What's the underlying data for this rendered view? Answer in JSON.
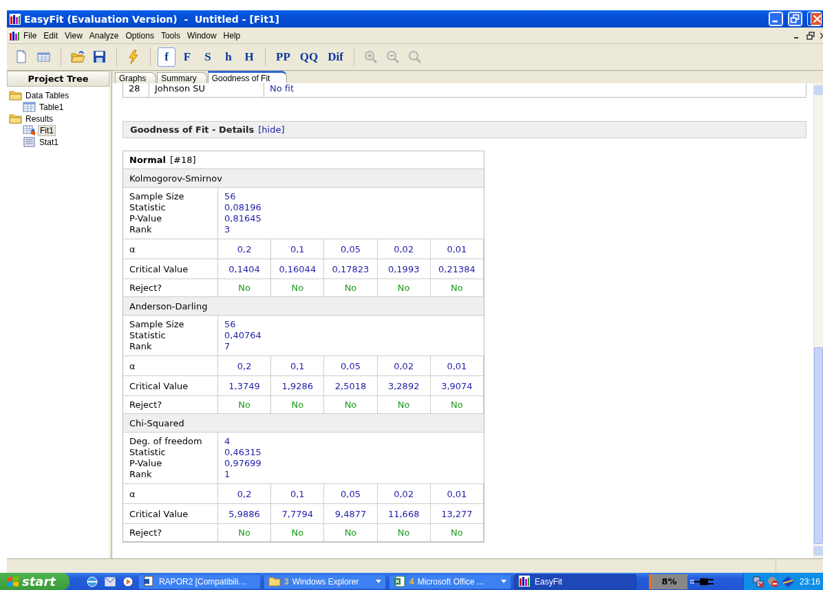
{
  "window": {
    "title": "EasyFit (Evaluation Version)  -  Untitled - [Fit1]"
  },
  "menu": [
    "File",
    "Edit",
    "View",
    "Analyze",
    "Options",
    "Tools",
    "Window",
    "Help"
  ],
  "toolbar": [
    {
      "kind": "new"
    },
    {
      "kind": "table"
    },
    {
      "kind": "separator"
    },
    {
      "kind": "open"
    },
    {
      "kind": "save"
    },
    {
      "kind": "separator"
    },
    {
      "kind": "run"
    },
    {
      "kind": "separator"
    },
    {
      "kind": "text",
      "label": "f",
      "selected": true
    },
    {
      "kind": "text",
      "label": "F",
      "selected": false
    },
    {
      "kind": "text",
      "label": "S",
      "selected": false
    },
    {
      "kind": "text",
      "label": "h",
      "selected": false
    },
    {
      "kind": "text",
      "label": "H",
      "selected": false
    },
    {
      "kind": "separator"
    },
    {
      "kind": "text",
      "label": "PP",
      "selected": false
    },
    {
      "kind": "text",
      "label": "QQ",
      "selected": false
    },
    {
      "kind": "text",
      "label": "Dif",
      "selected": false
    },
    {
      "kind": "separator"
    },
    {
      "kind": "zoom-in",
      "disabled": true
    },
    {
      "kind": "zoom-out",
      "disabled": true
    },
    {
      "kind": "zoom",
      "disabled": true
    }
  ],
  "sidebar": {
    "title": "Project Tree",
    "items": [
      {
        "label": "Data Tables",
        "kind": "folder",
        "selected": false,
        "children": [
          {
            "label": "Table1",
            "kind": "table",
            "selected": false
          }
        ]
      },
      {
        "label": "Results",
        "kind": "folder",
        "selected": false,
        "children": [
          {
            "label": "Fit1",
            "kind": "fit",
            "selected": true
          },
          {
            "label": "Stat1",
            "kind": "stat",
            "selected": false
          }
        ]
      }
    ]
  },
  "tabs": [
    {
      "label": "Graphs",
      "selected": false
    },
    {
      "label": "Summary",
      "selected": false
    },
    {
      "label": "Goodness of Fit",
      "selected": true
    }
  ],
  "partial_row": {
    "rank": "28",
    "distribution": "Johnson SU",
    "result": "No fit"
  },
  "details": {
    "title": "Goodness of Fit - Details",
    "toggle": "[hide]",
    "distribution": "Normal",
    "distribution_id": "[#18]",
    "tests": [
      {
        "name": "Kolmogorov-Smirnov",
        "stats": [
          {
            "label": "Sample Size",
            "value": "56"
          },
          {
            "label": "Statistic",
            "value": "0,08196"
          },
          {
            "label": "P-Value",
            "value": "0,81645"
          },
          {
            "label": "Rank",
            "value": "3"
          }
        ],
        "alpha_label": "α",
        "alphas": [
          "0,2",
          "0,1",
          "0,05",
          "0,02",
          "0,01"
        ],
        "critical_label": "Critical Value",
        "critical": [
          "0,1404",
          "0,16044",
          "0,17823",
          "0,1993",
          "0,21384"
        ],
        "reject_label": "Reject?",
        "reject": [
          "No",
          "No",
          "No",
          "No",
          "No"
        ]
      },
      {
        "name": "Anderson-Darling",
        "stats": [
          {
            "label": "Sample Size",
            "value": "56"
          },
          {
            "label": "Statistic",
            "value": "0,40764"
          },
          {
            "label": "Rank",
            "value": "7"
          }
        ],
        "alpha_label": "α",
        "alphas": [
          "0,2",
          "0,1",
          "0,05",
          "0,02",
          "0,01"
        ],
        "critical_label": "Critical Value",
        "critical": [
          "1,3749",
          "1,9286",
          "2,5018",
          "3,2892",
          "3,9074"
        ],
        "reject_label": "Reject?",
        "reject": [
          "No",
          "No",
          "No",
          "No",
          "No"
        ]
      },
      {
        "name": "Chi-Squared",
        "stats": [
          {
            "label": "Deg. of freedom",
            "value": "4"
          },
          {
            "label": "Statistic",
            "value": "0,46315"
          },
          {
            "label": "P-Value",
            "value": "0,97699"
          },
          {
            "label": "Rank",
            "value": "1"
          }
        ],
        "alpha_label": "α",
        "alphas": [
          "0,2",
          "0,1",
          "0,05",
          "0,02",
          "0,01"
        ],
        "critical_label": "Critical Value",
        "critical": [
          "5,9886",
          "7,7794",
          "9,4877",
          "11,668",
          "13,277"
        ],
        "reject_label": "Reject?",
        "reject": [
          "No",
          "No",
          "No",
          "No",
          "No"
        ]
      }
    ]
  },
  "taskbar": {
    "start": "start",
    "tasks": [
      {
        "label": "RAPOR2 [Compatibili…",
        "kind": "word",
        "selected": false
      },
      {
        "label": "Windows Explorer",
        "count": "3",
        "kind": "folder",
        "selected": false
      },
      {
        "label": "Microsoft Office ...",
        "count": "4",
        "kind": "excel",
        "selected": false
      },
      {
        "label": "EasyFit",
        "kind": "app",
        "selected": true
      }
    ],
    "meter": "8%",
    "clock": "23:16"
  }
}
